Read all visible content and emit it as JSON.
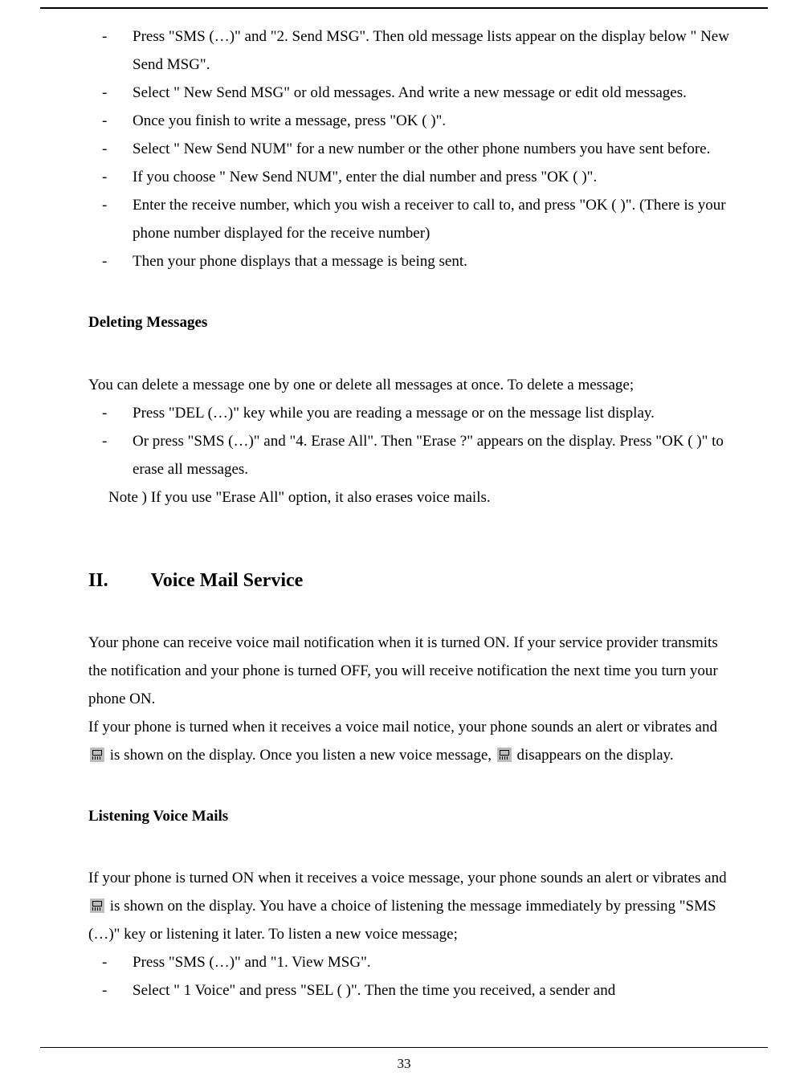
{
  "page_number": "33",
  "send": {
    "items": [
      "Press \"SMS (…)\" and \"2. Send MSG\". Then old message lists appear on the display below \"   New Send MSG\".",
      "Select \"   New Send MSG\" or old messages. And write a new message or edit old messages.",
      "Once you finish to write a message, press \"OK (   )\".",
      "Select \"   New Send NUM\" for a new number or the other phone numbers you have sent before.",
      "If you choose \"   New Send NUM\", enter the dial number and press \"OK (   )\".",
      "Enter the receive number, which you wish a receiver to call to, and press \"OK (   )\". (There is your phone number displayed for the receive number)",
      "Then your phone displays that a message is being sent."
    ]
  },
  "delete": {
    "heading": "Deleting Messages",
    "intro": "You can delete a message one by one or delete all messages at once. To delete a message;",
    "items": [
      "Press \"DEL (…)\" key while you are reading a message or on the message list display.",
      "Or press \"SMS (…)\" and \"4. Erase All\". Then \"Erase ?\" appears on the display. Press \"OK (   )\" to erase all messages."
    ],
    "note": "Note ) If you use \"Erase All\" option, it also erases voice mails."
  },
  "voicemail": {
    "roman": "II.",
    "title": "Voice Mail Service",
    "intro_a": "Your phone can receive voice mail notification when it is turned ON. If your service provider transmits the notification and your phone is turned OFF, you will receive notification the next time you turn your phone ON.",
    "intro_b_before": "If your phone is turned when it receives a voice mail notice, your phone sounds an alert or vibrates and ",
    "intro_b_mid": " is shown on the display. Once you listen a new voice message, ",
    "intro_b_after": " disappears on the display.",
    "sub_heading": "Listening Voice Mails",
    "sub_before": "If your phone is turned ON when it receives a voice message, your phone sounds an alert or vibrates and ",
    "sub_after": " is shown on the display. You have a choice of listening the message immediately by pressing \"SMS (…)\" key or listening it later. To listen a new voice message;",
    "items": [
      "Press \"SMS (…)\" and \"1. View MSG\".",
      "Select \"    1 Voice\" and press \"SEL (   )\". Then the time you received, a sender and"
    ]
  }
}
